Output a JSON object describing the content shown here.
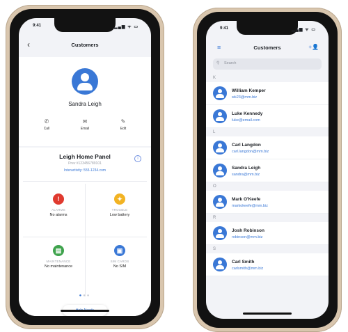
{
  "left_phone": {
    "status": {
      "time": "9:41",
      "signal": "▂▄▆ ᯤ ▭"
    },
    "nav": {
      "title": "Customers",
      "back": "‹"
    },
    "customer_name": "Sandra Leigh",
    "actions": [
      {
        "icon": "phone-icon",
        "glyph": "✆",
        "label": "Call"
      },
      {
        "icon": "email-icon",
        "glyph": "✉",
        "label": "Email"
      },
      {
        "icon": "edit-icon",
        "glyph": "✎",
        "label": "Edit"
      }
    ],
    "panel": {
      "title": "Leigh Home Panel",
      "subtitle": "Prev #123456789101",
      "link": "Interactivity: 555-1234.com",
      "info_glyph": "i"
    },
    "tiles": [
      {
        "icon": "alarm-icon",
        "color": "#e03a2f",
        "glyph": "!",
        "label": "ALARMS",
        "value": "No alarms"
      },
      {
        "icon": "trouble-icon",
        "color": "#f2b323",
        "glyph": "✦",
        "label": "TROUBLE",
        "value": "Low battery"
      },
      {
        "icon": "maintenance-icon",
        "color": "#3fa34d",
        "glyph": "▤",
        "label": "MAINTENANCE",
        "value": "No maintenance"
      },
      {
        "icon": "sim-card-icon",
        "color": "#3a78d6",
        "glyph": "▣",
        "label": "SIM CARDS",
        "value": "No SIM"
      }
    ],
    "pager": {
      "dots": 3,
      "active": 0
    },
    "help_button": "Help Needs"
  },
  "right_phone": {
    "status": {
      "time": "9:41",
      "signal": "▂▄▆ ᯤ ▭"
    },
    "nav": {
      "title": "Customers",
      "menu_glyph": "≡",
      "add_glyph": "+👤"
    },
    "search": {
      "placeholder": "Search",
      "glyph": "⚲"
    },
    "sections": [
      {
        "letter": "K",
        "rows": [
          {
            "name": "William Kemper",
            "email": "wk23@mm.biz"
          },
          {
            "name": "Luke Kennedy",
            "email": "luke@email.com"
          }
        ]
      },
      {
        "letter": "L",
        "rows": [
          {
            "name": "Carl Langdon",
            "email": "carl.langdon@mm.biz"
          },
          {
            "name": "Sandra Leigh",
            "email": "sandra@mm.biz"
          }
        ]
      },
      {
        "letter": "O",
        "rows": [
          {
            "name": "Mark O'Keefe",
            "email": "markokeefe@mm.biz"
          }
        ]
      },
      {
        "letter": "R",
        "rows": [
          {
            "name": "Josh Robinson",
            "email": "robinson@mm.biz"
          }
        ]
      },
      {
        "letter": "S",
        "rows": [
          {
            "name": "Carl Smith",
            "email": "carlsmith@mm.biz"
          }
        ]
      }
    ]
  }
}
